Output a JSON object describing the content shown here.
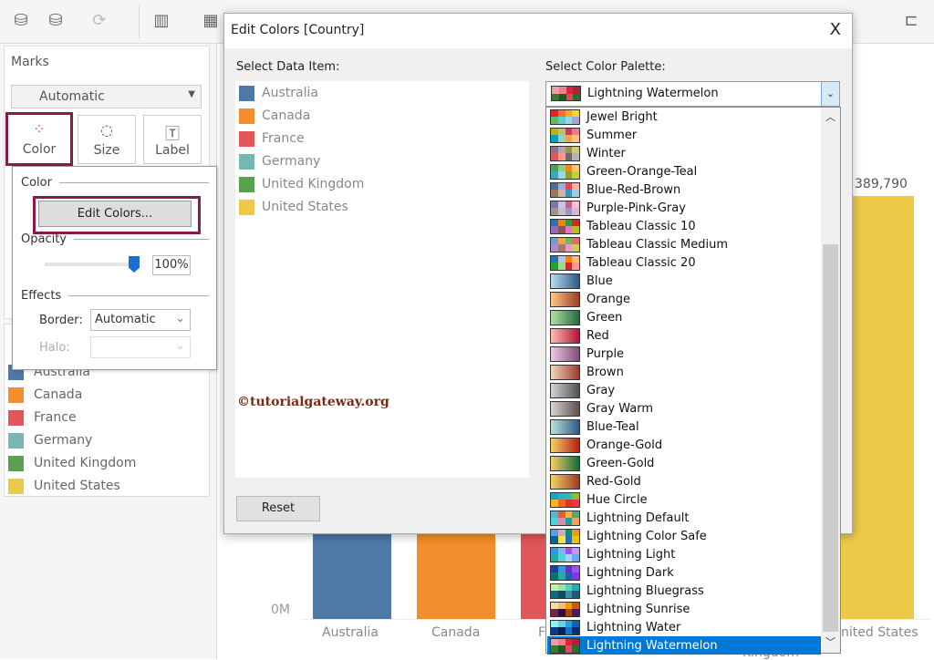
{
  "toolbar": {
    "icons": [
      "new-data-source-icon",
      "pause-updates-icon",
      "refresh-icon",
      "new-worksheet-icon",
      "show-me-icon",
      "presentation-icon"
    ]
  },
  "marks": {
    "title": "Marks",
    "mark_type": "Automatic",
    "buttons": [
      {
        "label": "Color"
      },
      {
        "label": "Size"
      },
      {
        "label": "Label"
      }
    ]
  },
  "color_popup": {
    "color_section": "Color",
    "edit_colors": "Edit Colors...",
    "opacity_section": "Opacity",
    "opacity_value": "100%",
    "opacity_percent": 100,
    "effects_section": "Effects",
    "border_label": "Border:",
    "border_value": "Automatic",
    "halo_label": "Halo:",
    "halo_value": ""
  },
  "legend": [
    {
      "label": "Australia",
      "color": "#4e79a7"
    },
    {
      "label": "Canada",
      "color": "#f28e2b"
    },
    {
      "label": "France",
      "color": "#e15759"
    },
    {
      "label": "Germany",
      "color": "#76b7b2"
    },
    {
      "label": "United Kingdom",
      "color": "#59a14f"
    },
    {
      "label": "United States",
      "color": "#edc948"
    }
  ],
  "chart": {
    "y_tick": "0M",
    "value_label": "389,790",
    "x_labels": [
      "Australia",
      "Canada",
      "F",
      "nited States",
      "Kingdom"
    ]
  },
  "dialog": {
    "title": "Edit Colors [Country]",
    "close": "X",
    "select_item_label": "Select Data Item:",
    "select_palette_label": "Select Color Palette:",
    "reset": "Reset",
    "watermark": "©tutorialgateway.org",
    "selected_palette": "Lightning Watermelon",
    "data_items": [
      "Australia",
      "Canada",
      "France",
      "Germany",
      "United Kingdom",
      "United States"
    ],
    "palettes": [
      {
        "name": "Jewel Bright",
        "colors": [
          "#eb1e2c",
          "#fd6f30",
          "#f9a729",
          "#f9d23c",
          "#5fbb68",
          "#64cdcc",
          "#91dcea",
          "#a4a4d5"
        ]
      },
      {
        "name": "Summer",
        "colors": [
          "#bfb202",
          "#b9ca5d",
          "#cf3e53",
          "#f1788d",
          "#00a2b3",
          "#97cfd0",
          "#f3a546",
          "#f7c480"
        ]
      },
      {
        "name": "Winter",
        "colors": [
          "#90728f",
          "#b9a0b4",
          "#9d983d",
          "#cecb76",
          "#e15759",
          "#ff9888",
          "#6b6b6b",
          "#bab2ae"
        ]
      },
      {
        "name": "Green-Orange-Teal",
        "colors": [
          "#4e9f50",
          "#87d180",
          "#ef8a0c",
          "#fcc66d",
          "#3ca8bc",
          "#98d9e4",
          "#94a323",
          "#c3ce3d"
        ]
      },
      {
        "name": "Blue-Red-Brown",
        "colors": [
          "#466f9d",
          "#91b3d7",
          "#ed444a",
          "#feb5a2",
          "#9d7660",
          "#d7b5a6",
          "#3896c3",
          "#a4ccdb"
        ]
      },
      {
        "name": "Purple-Pink-Gray",
        "colors": [
          "#8074a8",
          "#c6c1f0",
          "#c46487",
          "#ffbed1",
          "#9c9290",
          "#c5bfbe",
          "#9b93c9",
          "#ddb5d5"
        ]
      },
      {
        "name": "Tableau Classic 10",
        "colors": [
          "#1f77b4",
          "#ff7f0e",
          "#2ca02c",
          "#d62728",
          "#9467bd",
          "#8c564b",
          "#e377c2",
          "#bcbd22"
        ]
      },
      {
        "name": "Tableau Classic Medium",
        "colors": [
          "#729ece",
          "#ff9e4a",
          "#67bf5c",
          "#ed665d",
          "#ad8bc9",
          "#a8786e",
          "#ed97ca",
          "#cdcc5d"
        ]
      },
      {
        "name": "Tableau Classic 20",
        "colors": [
          "#1f77b4",
          "#aec7e8",
          "#ff7f0e",
          "#ffbb78",
          "#2ca02c",
          "#98df8a",
          "#d62728",
          "#ff9896"
        ]
      },
      {
        "name": "Blue",
        "colors": [
          "#b9ddf1",
          "#2a5783"
        ]
      },
      {
        "name": "Orange",
        "colors": [
          "#ffc685",
          "#9e3d22"
        ]
      },
      {
        "name": "Green",
        "colors": [
          "#b3e0a6",
          "#24693d"
        ]
      },
      {
        "name": "Red",
        "colors": [
          "#ffbeb2",
          "#ae123a"
        ]
      },
      {
        "name": "Purple",
        "colors": [
          "#eec9e5",
          "#7c4d79"
        ]
      },
      {
        "name": "Brown",
        "colors": [
          "#eedbbd",
          "#9f3632"
        ]
      },
      {
        "name": "Gray",
        "colors": [
          "#d5d5d5",
          "#4f4f4f"
        ]
      },
      {
        "name": "Gray Warm",
        "colors": [
          "#dcd4d0",
          "#59504e"
        ]
      },
      {
        "name": "Blue-Teal",
        "colors": [
          "#bce4d8",
          "#2c5985"
        ]
      },
      {
        "name": "Orange-Gold",
        "colors": [
          "#f4d166",
          "#b71d13"
        ]
      },
      {
        "name": "Green-Gold",
        "colors": [
          "#f4d166",
          "#146c36"
        ]
      },
      {
        "name": "Red-Gold",
        "colors": [
          "#f4d166",
          "#9e3a26"
        ]
      },
      {
        "name": "Hue Circle",
        "colors": [
          "#1ba3c6",
          "#2cb5c0",
          "#30bcad",
          "#a2b627",
          "#f8b620",
          "#f06719",
          "#e03426",
          "#eb364a"
        ]
      },
      {
        "name": "Lightning Default",
        "colors": [
          "#52b7d8",
          "#e16032",
          "#ffb03b",
          "#54a77b",
          "#4fd2d2",
          "#e287b2",
          "#2a9d8f",
          "#f4a261"
        ]
      },
      {
        "name": "Lightning Color Safe",
        "colors": [
          "#529ee0",
          "#d9a6c2",
          "#08916d",
          "#f59b00",
          "#006699",
          "#f0e442",
          "#2a6ebb",
          "#e7c700"
        ]
      },
      {
        "name": "Lightning Light",
        "colors": [
          "#3296ed",
          "#77b9f2",
          "#9d53f2",
          "#c398f5",
          "#26aba4",
          "#4ed4cd",
          "#a5d4f6",
          "#6aa8f0"
        ]
      },
      {
        "name": "Lightning Dark",
        "colors": [
          "#1e3ba7",
          "#3296ed",
          "#6b27d3",
          "#9d53f2",
          "#06746e",
          "#26aba4",
          "#1c5fb0",
          "#7c3ae0"
        ]
      },
      {
        "name": "Lightning Bluegrass",
        "colors": [
          "#c7f296",
          "#94e7a8",
          "#51d2bb",
          "#27aab0",
          "#116985",
          "#0f4d63",
          "#3a8fa5",
          "#1e5b7a"
        ]
      },
      {
        "name": "Lightning Sunrise",
        "colors": [
          "#f5de98",
          "#f5c066",
          "#f59b00",
          "#d15600",
          "#73244b",
          "#2a0e4a",
          "#b54100",
          "#481a5e"
        ]
      },
      {
        "name": "Lightning Water",
        "colors": [
          "#96f2ee",
          "#68ceee",
          "#2d9cdc",
          "#0d62b7",
          "#0a3a82",
          "#0f1f56",
          "#1a71c5",
          "#0b2d6b"
        ]
      },
      {
        "name": "Lightning Watermelon",
        "colors": [
          "#f39caa",
          "#f87b8c",
          "#e1213c",
          "#b0203b",
          "#3a7b2c",
          "#1c5a1f",
          "#e04a5c",
          "#2f6b2a"
        ]
      }
    ]
  }
}
